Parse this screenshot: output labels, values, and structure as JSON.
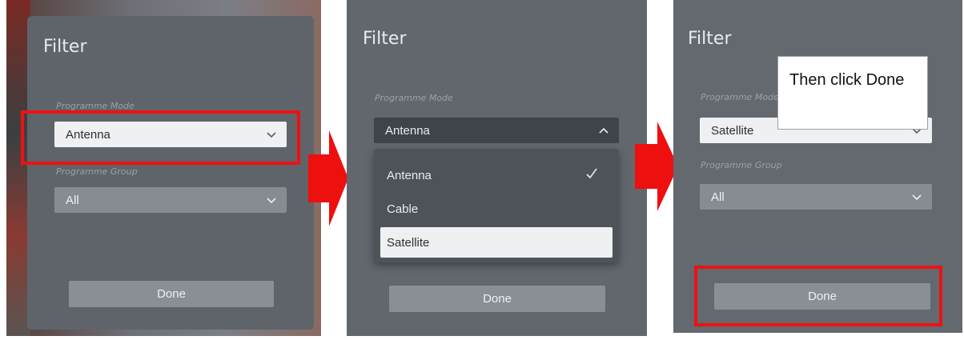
{
  "colors": {
    "highlight": "#ee1111",
    "arrow": "#ee0f0f"
  },
  "panels": [
    {
      "dialog_title": "Filter",
      "mode_label": "Programme Mode",
      "mode_value": "Antenna",
      "group_label": "Programme Group",
      "group_value": "All",
      "done_label": "Done"
    },
    {
      "dialog_title": "Filter",
      "mode_label": "Programme Mode",
      "mode_value": "Antenna",
      "options": [
        "Antenna",
        "Cable",
        "Satellite"
      ],
      "checked_option": "Antenna",
      "hovered_option": "Satellite",
      "done_label": "Done"
    },
    {
      "dialog_title": "Filter",
      "mode_label": "Programme Mode",
      "mode_value": "Satellite",
      "group_label": "Programme Group",
      "group_value": "All",
      "done_label": "Done",
      "callout_text": "Then click Done"
    }
  ],
  "icons": {
    "chevron": "chevron-down-icon",
    "chevron_up": "chevron-up-icon",
    "check": "check-icon",
    "arrow": "arrow-right-icon"
  }
}
